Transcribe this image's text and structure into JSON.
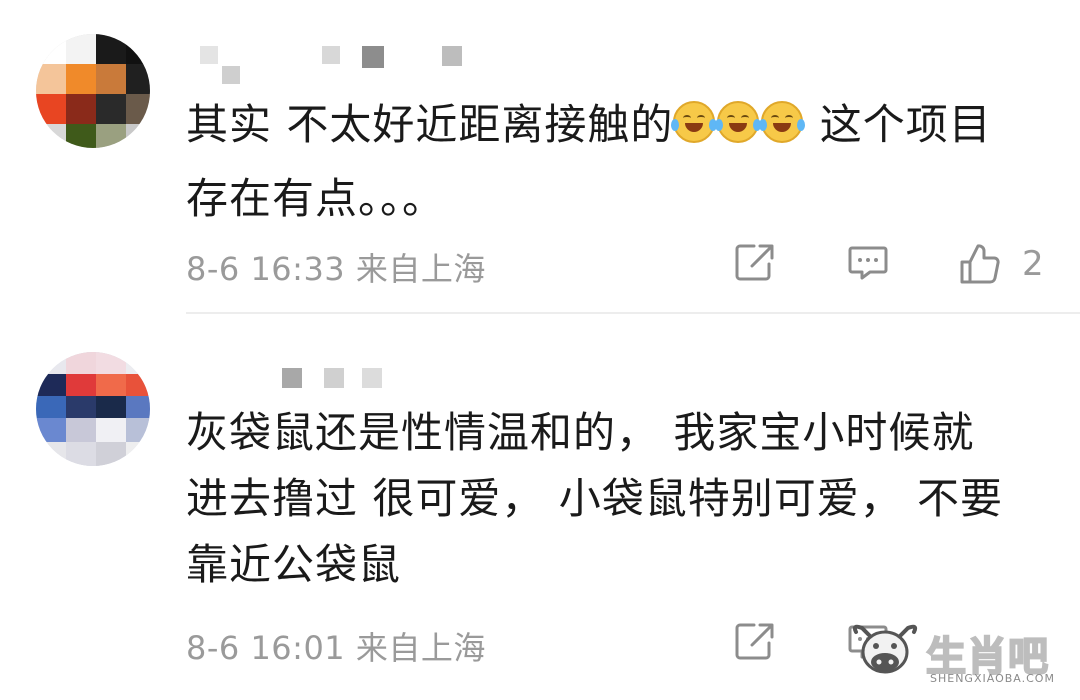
{
  "comments": [
    {
      "text_lines": [
        "其实 不太好近距离接触的",
        "存在有点。。。"
      ],
      "emoji_tail": "这个项目",
      "emoji_name": "laughing-crying-emoji",
      "emoji_count": 3,
      "timestamp": "8-6 16:33",
      "location": "来自上海",
      "like_count": "2"
    },
    {
      "text_lines": [
        "灰袋鼠还是性情温和的， 我家宝小时候就",
        "进去撸过 很可爱， 小袋鼠特别可爱， 不要",
        "靠近公袋鼠"
      ],
      "timestamp": "8-6 16:01",
      "location": "来自上海",
      "like_count": ""
    }
  ],
  "watermark": {
    "text": "生肖吧",
    "subtext": "SHENGXIAOBA.COM"
  },
  "icons": {
    "share": "share-icon",
    "comment": "comment-icon",
    "like": "thumbs-up-icon"
  }
}
